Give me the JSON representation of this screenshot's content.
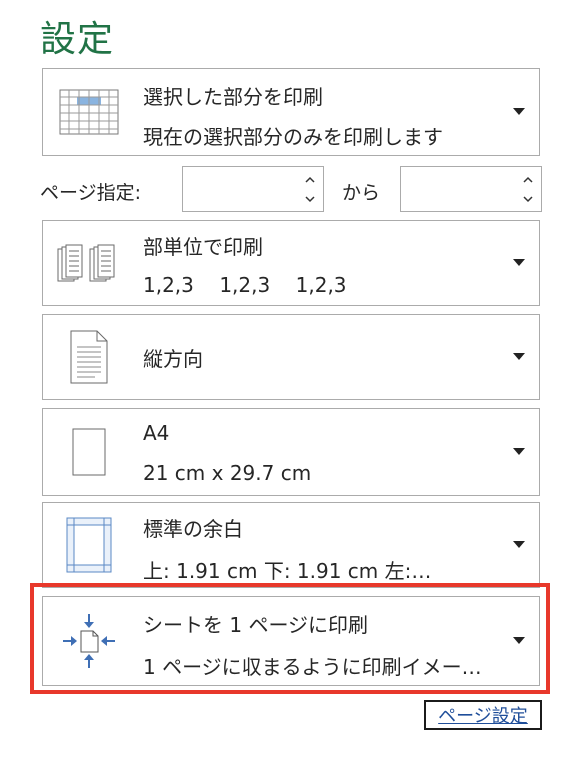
{
  "title": "設定",
  "options": [
    {
      "line1": "選択した部分を印刷",
      "line2": "現在の選択部分のみを印刷します",
      "icon": "selection-grid-icon"
    },
    {
      "line1": "部単位で印刷",
      "line2": "1,2,3    1,2,3    1,2,3",
      "icon": "collate-icon"
    },
    {
      "line1": "縦方向",
      "line2": "",
      "icon": "portrait-page-icon"
    },
    {
      "line1": "A4",
      "line2": "21 cm x 29.7 cm",
      "icon": "paper-size-icon"
    },
    {
      "line1": "標準の余白",
      "line2": "上: 1.91 cm 下: 1.91 cm 左:…",
      "icon": "margins-icon"
    },
    {
      "line1": "シートを 1 ページに印刷",
      "line2": "1 ページに収まるように印刷イメー…",
      "icon": "fit-to-page-icon"
    }
  ],
  "pages": {
    "label": "ページ指定:",
    "to_label": "から",
    "from_value": "",
    "to_value": ""
  },
  "page_setup_link": "ページ設定",
  "colors": {
    "title": "#217346",
    "highlight": "#e8382b",
    "link": "#1f4e9a",
    "icon_blue": "#3f6fb5"
  }
}
